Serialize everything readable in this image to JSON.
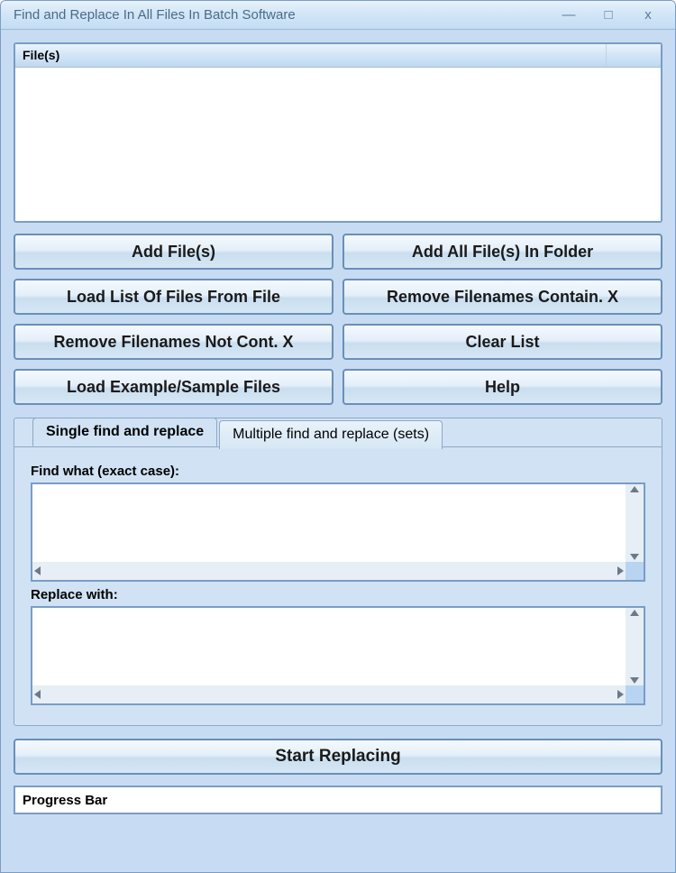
{
  "window": {
    "title": "Find and Replace In All Files In Batch Software"
  },
  "filesPanel": {
    "headerCol1": "File(s)",
    "headerCol2": ""
  },
  "buttons": {
    "addFiles": "Add File(s)",
    "addAllInFolder": "Add All File(s) In Folder",
    "loadListFromFile": "Load List Of Files From File",
    "removeContain": "Remove Filenames Contain. X",
    "removeNotContain": "Remove Filenames Not Cont. X",
    "clearList": "Clear List",
    "loadSample": "Load Example/Sample Files",
    "help": "Help"
  },
  "tabs": {
    "single": "Single find and replace",
    "multiple": "Multiple find and replace (sets)"
  },
  "fields": {
    "findLabel": "Find what (exact case):",
    "replaceLabel": "Replace with:",
    "findValue": "",
    "replaceValue": ""
  },
  "start": {
    "label": "Start Replacing"
  },
  "progress": {
    "label": "Progress Bar"
  }
}
